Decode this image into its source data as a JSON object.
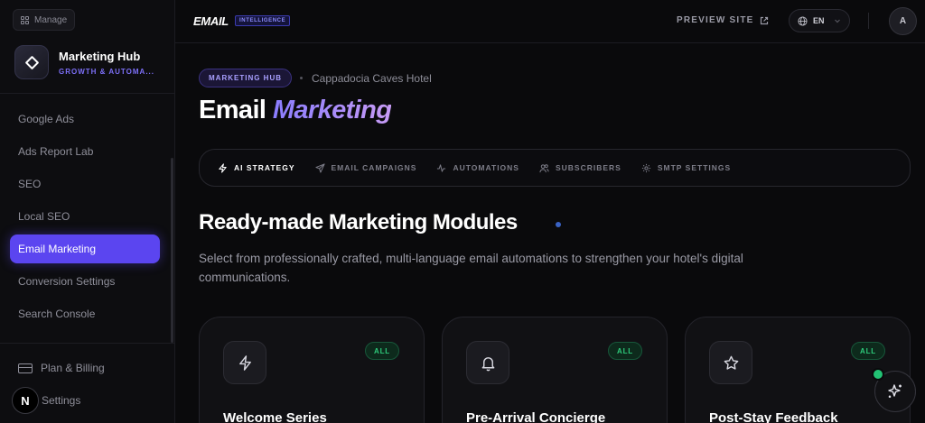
{
  "sidebar": {
    "manage_label": "Manage",
    "brand_title": "Marketing Hub",
    "brand_subtitle": "GROWTH & AUTOMA...",
    "items": [
      {
        "label": "Google Ads",
        "active": false
      },
      {
        "label": "Ads Report Lab",
        "active": false
      },
      {
        "label": "SEO",
        "active": false
      },
      {
        "label": "Local SEO",
        "active": false
      },
      {
        "label": "Email Marketing",
        "active": true
      },
      {
        "label": "Conversion Settings",
        "active": false
      },
      {
        "label": "Search Console",
        "active": false
      }
    ],
    "plan_billing": "Plan & Billing",
    "settings": "Settings",
    "n_badge": "N"
  },
  "topbar": {
    "logo_text": "EMAIL",
    "logo_badge": "INTELLIGENCE",
    "preview_site": "PREVIEW SITE",
    "language": "EN",
    "avatar_initial": "A"
  },
  "main": {
    "breadcrumb_pill": "MARKETING HUB",
    "breadcrumb_hotel": "Cappadocia Caves Hotel",
    "title_plain": "Email",
    "title_accent": "Marketing",
    "tabs": [
      {
        "label": "AI STRATEGY",
        "icon": "bolt-icon",
        "active": true
      },
      {
        "label": "EMAIL CAMPAIGNS",
        "icon": "send-icon",
        "active": false
      },
      {
        "label": "AUTOMATIONS",
        "icon": "activity-icon",
        "active": false
      },
      {
        "label": "SUBSCRIBERS",
        "icon": "users-icon",
        "active": false
      },
      {
        "label": "SMTP SETTINGS",
        "icon": "gear-icon",
        "active": false
      }
    ],
    "section_title": "Ready-made Marketing Modules",
    "section_description": "Select from professionally crafted, multi-language email automations to strengthen your hotel's digital communications.",
    "modules": [
      {
        "title": "Welcome Series",
        "badge": "ALL",
        "icon": "bolt-icon"
      },
      {
        "title": "Pre-Arrival Concierge",
        "badge": "ALL",
        "icon": "bell-icon"
      },
      {
        "title": "Post-Stay Feedback",
        "badge": "ALL",
        "icon": "star-icon"
      }
    ]
  },
  "colors": {
    "accent": "#5b45f0",
    "success": "#2ecb7b",
    "background": "#0a0a0c"
  }
}
